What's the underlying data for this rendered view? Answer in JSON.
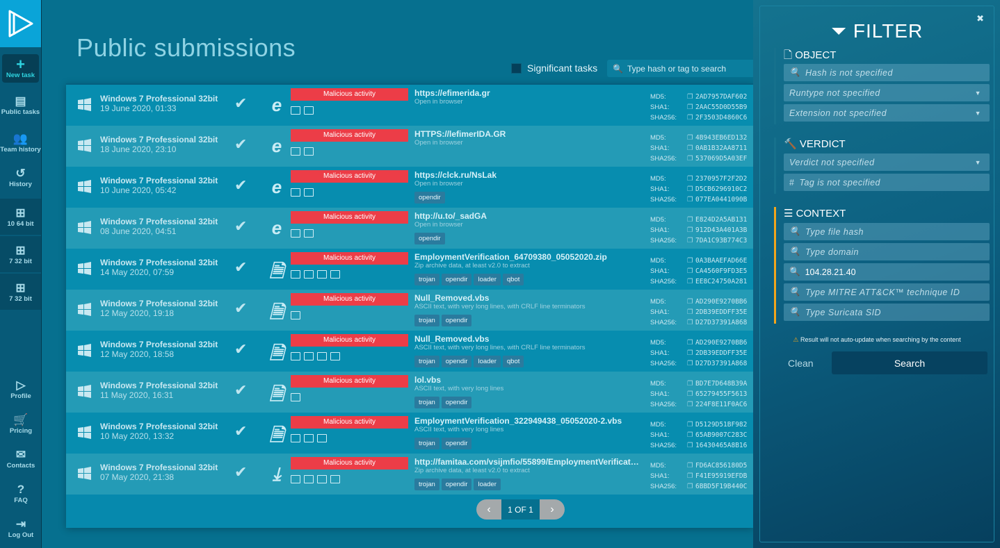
{
  "sidebar": {
    "new_task": "New task",
    "items": [
      {
        "label": "Public tasks",
        "icon": "document-icon"
      },
      {
        "label": "Team history",
        "icon": "team-history-icon"
      },
      {
        "label": "History",
        "icon": "history-icon"
      }
    ],
    "os": [
      {
        "label": "10 64 bit",
        "icon": "windows-10-icon"
      },
      {
        "label": "7 32 bit",
        "icon": "windows-7-icon"
      },
      {
        "label": "7 32 bit",
        "icon": "windows-7-icon"
      }
    ],
    "bottom": [
      {
        "label": "Profile",
        "icon": "profile-icon"
      },
      {
        "label": "Pricing",
        "icon": "cart-icon"
      },
      {
        "label": "Contacts",
        "icon": "mail-icon"
      },
      {
        "label": "FAQ",
        "icon": "question-icon"
      },
      {
        "label": "Log Out",
        "icon": "logout-icon"
      }
    ]
  },
  "main": {
    "title": "Public submissions",
    "significant_label": "Significant tasks",
    "significant_checked": false,
    "search_placeholder": "Type hash or tag to search",
    "hash_labels": {
      "md5": "MD5:",
      "sha1": "SHA1:",
      "sha256": "SHA256:"
    },
    "tasks": [
      {
        "os": "Windows 7 Professional 32bit",
        "date": "19 June 2020, 01:33",
        "type": "ie",
        "verdict": "Malicious activity",
        "icons": 2,
        "name": "https://efimerida.gr",
        "desc": "Open in browser",
        "tags": [],
        "md5": "2AD7957DAF602",
        "sha1": "2AAC55D0D55B9",
        "sha256": "2F3503D4860C6"
      },
      {
        "os": "Windows 7 Professional 32bit",
        "date": "18 June 2020, 23:10",
        "type": "ie",
        "verdict": "Malicious activity",
        "icons": 2,
        "name": "HTTPS://lefimerIDA.GR",
        "desc": "Open in browser",
        "tags": [],
        "md5": "4B943EB6ED132",
        "sha1": "0AB1B32AA8711",
        "sha256": "537069D5A03EF"
      },
      {
        "os": "Windows 7 Professional 32bit",
        "date": "10 June 2020, 05:42",
        "type": "ie",
        "verdict": "Malicious activity",
        "icons": 2,
        "name": "https://clck.ru/NsLak",
        "desc": "Open in browser",
        "tags": [
          "opendir"
        ],
        "md5": "2370957F2F2D2",
        "sha1": "D5CB6296910C2",
        "sha256": "077EA0441090B"
      },
      {
        "os": "Windows 7 Professional 32bit",
        "date": "08 June 2020, 04:51",
        "type": "ie",
        "verdict": "Malicious activity",
        "icons": 2,
        "name": "http://u.to/_sadGA",
        "desc": "Open in browser",
        "tags": [
          "opendir"
        ],
        "md5": "E824D2A5AB131",
        "sha1": "912D43A401A3B",
        "sha256": "7DA1C93B774C3"
      },
      {
        "os": "Windows 7 Professional 32bit",
        "date": "14 May 2020, 07:59",
        "type": "file",
        "verdict": "Malicious activity",
        "icons": 4,
        "name": "EmploymentVerification_64709380_05052020.zip",
        "desc": "Zip archive data, at least v2.0 to extract",
        "tags": [
          "trojan",
          "opendir",
          "loader",
          "qbot"
        ],
        "md5": "0A3BAAEFAD66E",
        "sha1": "CA4560F9FD3E5",
        "sha256": "EE8C24750A281"
      },
      {
        "os": "Windows 7 Professional 32bit",
        "date": "12 May 2020, 19:18",
        "type": "file",
        "verdict": "Malicious activity",
        "icons": 1,
        "name": "Null_Removed.vbs",
        "desc": "ASCII text, with very long lines, with CRLF line terminators",
        "tags": [
          "trojan",
          "opendir"
        ],
        "md5": "AD290E9270BB6",
        "sha1": "2DB39EDDFF35E",
        "sha256": "D27D37391A868"
      },
      {
        "os": "Windows 7 Professional 32bit",
        "date": "12 May 2020, 18:58",
        "type": "file",
        "verdict": "Malicious activity",
        "icons": 4,
        "name": "Null_Removed.vbs",
        "desc": "ASCII text, with very long lines, with CRLF line terminators",
        "tags": [
          "trojan",
          "opendir",
          "loader",
          "qbot"
        ],
        "md5": "AD290E9270BB6",
        "sha1": "2DB39EDDFF35E",
        "sha256": "D27D37391A868"
      },
      {
        "os": "Windows 7 Professional 32bit",
        "date": "11 May 2020, 16:31",
        "type": "file",
        "verdict": "Malicious activity",
        "icons": 1,
        "name": "lol.vbs",
        "desc": "ASCII text, with very long lines",
        "tags": [
          "trojan",
          "opendir"
        ],
        "md5": "BD7E7D648B39A",
        "sha1": "65279455F5613",
        "sha256": "224F8E11F0AC6"
      },
      {
        "os": "Windows 7 Professional 32bit",
        "date": "10 May 2020, 13:32",
        "type": "file",
        "verdict": "Malicious activity",
        "icons": 3,
        "name": "EmploymentVerification_322949438_05052020-2.vbs",
        "desc": "ASCII text, with very long lines",
        "tags": [
          "trojan",
          "opendir"
        ],
        "md5": "D5129D51BF982",
        "sha1": "65AB9007C283C",
        "sha256": "16430465A8B16"
      },
      {
        "os": "Windows 7 Professional 32bit",
        "date": "07 May 2020, 21:38",
        "type": "download",
        "verdict": "Malicious activity",
        "icons": 4,
        "name": "http://famitaa.com/vsijmfio/55899/EmploymentVerificatio...",
        "desc": "Zip archive data, at least v2.0 to extract",
        "tags": [
          "trojan",
          "opendir",
          "loader"
        ],
        "md5": "FD6AC856180D5",
        "sha1": "F41E95919EFDB",
        "sha256": "6BBD5F19B440C"
      }
    ],
    "pager": {
      "prev": "‹",
      "label": "1 OF 1",
      "next": "›"
    }
  },
  "filter": {
    "title": "FILTER",
    "object": {
      "heading": "OBJECT",
      "hash": "Hash is not specified",
      "runtype": "Runtype not specified",
      "extension": "Extension not specified"
    },
    "verdict": {
      "heading": "VERDICT",
      "verdict": "Verdict not specified",
      "tag": "Tag is not specified"
    },
    "context": {
      "heading": "CONTEXT",
      "file_hash": "Type file hash",
      "domain": "Type domain",
      "ip": "104.28.21.40",
      "mitre": "Type MITRE ATT&CK™ technique ID",
      "suricata": "Type Suricata SID"
    },
    "warning": "Result will not auto-update when searching by the content",
    "clean": "Clean",
    "search": "Search"
  },
  "colors": {
    "malicious": "#ec3d47",
    "context_accent": "#f2a51b",
    "logo_bg": "#0aa4d8"
  }
}
